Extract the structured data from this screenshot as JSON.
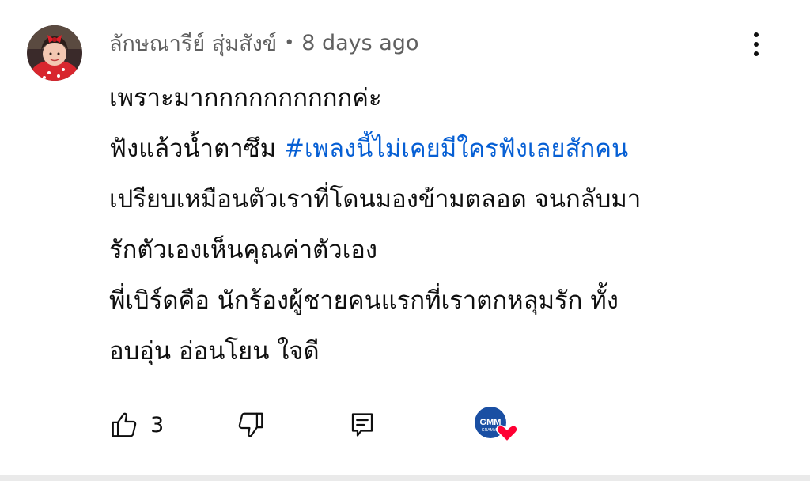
{
  "comment": {
    "author": "ลักษณารีย์ สุ่มสังข์",
    "separator": "•",
    "time": "8 days ago",
    "lines": {
      "l1": "เพราะมากกกกกกกกกกค่ะ",
      "l2_text": "ฟังแล้วน้ำตาซึม ",
      "l2_hashtag": "#เพลงนี้ไม่เคยมีใครฟังเลยสักคน",
      "l3": "เปรียบเหมือนตัวเราที่โดนมองข้ามตลอด จนกลับมา",
      "l4": "รักตัวเองเห็นคุณค่าตัวเอง",
      "l5": "พี่เบิร์ดคือ นักร้องผู้ชายคนแรกที่เราตกหลุมรัก ทั้ง",
      "l6": "อบอุ่น อ่อนโยน ใจดี"
    },
    "actions": {
      "like_count": "3"
    }
  },
  "creator_heart": {
    "badge_text": "GMM",
    "badge_subtext": "GRAMMY",
    "heart_color": "#ff0033",
    "badge_color": "#1a4fa3"
  },
  "icons": {
    "like": "thumbs-up-icon",
    "dislike": "thumbs-down-icon",
    "reply": "reply-icon",
    "more": "more-vertical-icon",
    "heart": "heart-icon"
  },
  "colors": {
    "meta": "#606060",
    "text": "#0f0f0f",
    "hashtag": "#065fd4"
  }
}
